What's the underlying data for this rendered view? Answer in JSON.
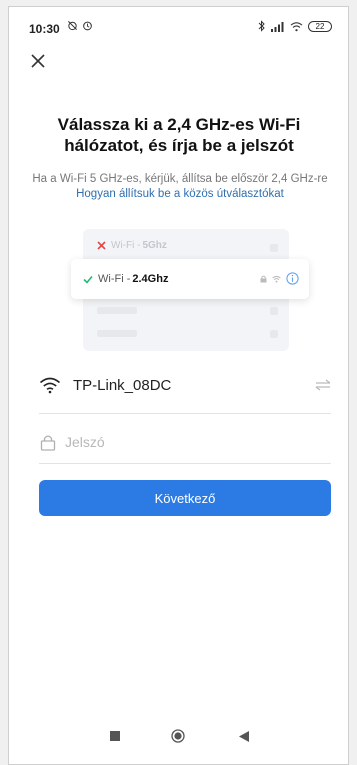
{
  "status_bar": {
    "time": "10:30",
    "battery": "22"
  },
  "title": "Válassza ki a 2,4 GHz-es Wi-Fi hálózatot, és írja be a jelszót",
  "subtitle": {
    "text": "Ha a Wi-Fi 5 GHz-es, kérjük, állítsa be először 2,4 GHz-re",
    "link": "Hogyan állítsuk be a közös útválasztókat"
  },
  "illustration": {
    "row_5ghz_prefix": "Wi-Fi - ",
    "row_5ghz_band": "5Ghz",
    "row_24ghz_prefix": "Wi-Fi - ",
    "row_24ghz_band": "2.4Ghz"
  },
  "form": {
    "ssid": "TP-Link_08DC",
    "password_placeholder": "Jelszó",
    "password_value": ""
  },
  "next_button": "Következő",
  "colors": {
    "accent": "#2c7be5",
    "link": "#2f6fb0",
    "check": "#1fb978",
    "error": "#e84545"
  }
}
